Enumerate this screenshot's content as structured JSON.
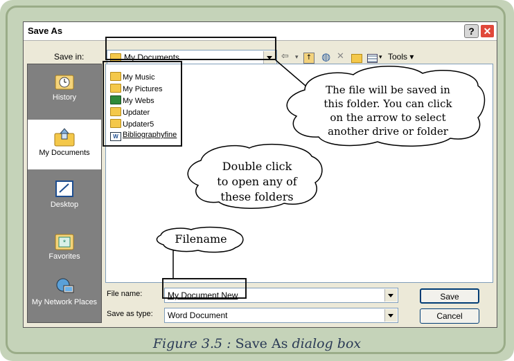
{
  "dialog": {
    "title": "Save As",
    "help_label": "?",
    "close_label": "✕"
  },
  "save_in": {
    "label": "Save in:",
    "value": "My Documents"
  },
  "toolbar": {
    "tools_label": "Tools"
  },
  "places": [
    {
      "label": "History",
      "icon": "history-icon"
    },
    {
      "label": "My Documents",
      "icon": "my-documents-icon"
    },
    {
      "label": "Desktop",
      "icon": "desktop-icon"
    },
    {
      "label": "Favorites",
      "icon": "favorites-icon"
    },
    {
      "label": "My Network Places",
      "icon": "network-places-icon"
    }
  ],
  "files": [
    {
      "name": "My Music",
      "icon": "folder-icon"
    },
    {
      "name": "My Pictures",
      "icon": "folder-icon"
    },
    {
      "name": "My Webs",
      "icon": "web-folder-icon"
    },
    {
      "name": "Updater",
      "icon": "folder-icon"
    },
    {
      "name": "Updater5",
      "icon": "folder-icon"
    },
    {
      "name": "Bibliographyfine",
      "icon": "word-document-icon"
    }
  ],
  "file_name": {
    "label": "File name:",
    "value": "My Document New"
  },
  "save_as_type": {
    "label": "Save as type:",
    "value": "Word Document"
  },
  "buttons": {
    "save": "Save",
    "cancel": "Cancel"
  },
  "callouts": {
    "save_folder": [
      "The file will be saved in",
      "this folder. You can click",
      "on the arrow to select",
      "another drive or folder"
    ],
    "double_click": [
      "Double click",
      "to open any of",
      "these folders"
    ],
    "filename": "Filename"
  },
  "caption": {
    "figure": "Figure 3.5 :",
    "name": "Save As",
    "rest": "dialog box"
  }
}
